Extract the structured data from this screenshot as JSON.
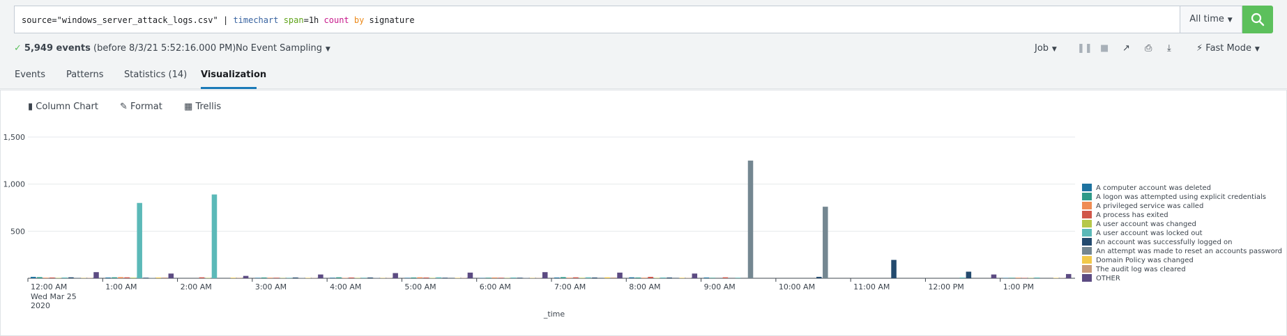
{
  "search": {
    "query_parts": [
      {
        "text": "source=\"windows_server_attack_logs.csv\" | ",
        "style": "plain"
      },
      {
        "text": "timechart",
        "style": "blue"
      },
      {
        "text": " ",
        "style": "plain"
      },
      {
        "text": "span",
        "style": "green"
      },
      {
        "text": "=1h ",
        "style": "plain"
      },
      {
        "text": "count",
        "style": "pink"
      },
      {
        "text": " ",
        "style": "plain"
      },
      {
        "text": "by",
        "style": "orange"
      },
      {
        "text": " signature",
        "style": "plain"
      }
    ],
    "time_range": "All time",
    "search_icon": "magnifier-icon"
  },
  "status": {
    "count_text": "5,949 events",
    "detail_text": "(before 8/3/21 5:52:16.000 PM)",
    "sampling_label": "No Event Sampling",
    "job_label": "Job",
    "mode_label": "Fast Mode"
  },
  "tabs": [
    {
      "label": "Events",
      "active": false
    },
    {
      "label": "Patterns",
      "active": false
    },
    {
      "label": "Statistics (14)",
      "active": false
    },
    {
      "label": "Visualization",
      "active": true
    }
  ],
  "viz_toolbar": {
    "chart_type_label": "Column Chart",
    "format_label": "Format",
    "trellis_label": "Trellis"
  },
  "chart_data": {
    "type": "bar",
    "xlabel": "_time",
    "ylabel": "",
    "ylim": [
      0,
      1500
    ],
    "yticks": [
      "1,500",
      "1,000",
      "500"
    ],
    "x": [
      "12:00 AM",
      "1:00 AM",
      "2:00 AM",
      "3:00 AM",
      "4:00 AM",
      "5:00 AM",
      "6:00 AM",
      "7:00 AM",
      "8:00 AM",
      "9:00 AM",
      "10:00 AM",
      "11:00 AM",
      "12:00 PM",
      "1:00 PM"
    ],
    "x_first_sublabels": [
      "Wed Mar 25",
      "2020"
    ],
    "legend_position": "right",
    "series": [
      {
        "name": "A computer account was deleted",
        "color": "#1e73a0",
        "values": [
          15,
          8,
          0,
          5,
          6,
          5,
          4,
          8,
          10,
          8,
          0,
          0,
          0,
          4
        ]
      },
      {
        "name": "A logon was attempted using explicit credentials",
        "color": "#2e9a88",
        "values": [
          12,
          10,
          0,
          8,
          10,
          8,
          6,
          12,
          8,
          5,
          0,
          0,
          0,
          5
        ]
      },
      {
        "name": "A privileged service was called",
        "color": "#ef8c54",
        "values": [
          6,
          12,
          0,
          6,
          4,
          10,
          8,
          6,
          6,
          0,
          0,
          0,
          0,
          6
        ]
      },
      {
        "name": "A process has exited",
        "color": "#d0574a",
        "values": [
          8,
          10,
          10,
          6,
          8,
          8,
          6,
          10,
          15,
          10,
          0,
          0,
          0,
          4
        ]
      },
      {
        "name": "A user account was changed",
        "color": "#b6c84a",
        "values": [
          4,
          6,
          4,
          3,
          4,
          4,
          3,
          5,
          4,
          0,
          0,
          0,
          0,
          3
        ]
      },
      {
        "name": "A user account was locked out",
        "color": "#5bb9b8",
        "values": [
          8,
          800,
          890,
          5,
          6,
          10,
          8,
          10,
          8,
          6,
          0,
          0,
          8,
          8
        ]
      },
      {
        "name": "An account was successfully logged on",
        "color": "#234a6e",
        "values": [
          10,
          6,
          0,
          8,
          8,
          6,
          6,
          8,
          8,
          0,
          15,
          195,
          70,
          0
        ]
      },
      {
        "name": "An attempt was made to reset an accounts password",
        "color": "#748791",
        "values": [
          5,
          4,
          0,
          4,
          4,
          6,
          4,
          6,
          6,
          1250,
          760,
          0,
          0,
          0
        ]
      },
      {
        "name": "Domain Policy was changed",
        "color": "#f2c94a",
        "values": [
          3,
          8,
          6,
          4,
          3,
          4,
          3,
          10,
          5,
          0,
          0,
          0,
          0,
          4
        ]
      },
      {
        "name": "The audit log was cleared",
        "color": "#c99a7a",
        "values": [
          4,
          8,
          5,
          3,
          3,
          4,
          3,
          8,
          3,
          0,
          0,
          0,
          0,
          3
        ]
      },
      {
        "name": "OTHER",
        "color": "#5c4b82",
        "values": [
          65,
          50,
          25,
          40,
          55,
          60,
          65,
          60,
          50,
          0,
          0,
          0,
          40,
          45
        ]
      }
    ]
  }
}
